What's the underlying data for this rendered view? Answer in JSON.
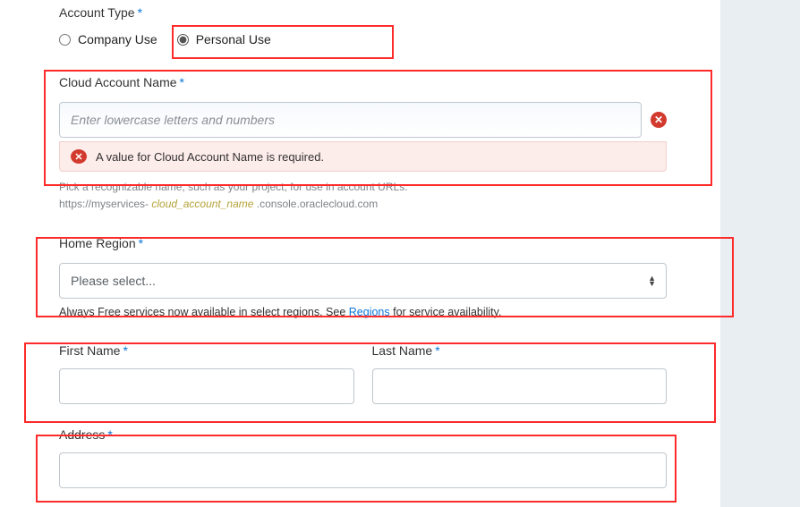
{
  "account_type": {
    "label": "Account Type",
    "options": [
      {
        "label": "Company Use",
        "selected": false
      },
      {
        "label": "Personal Use",
        "selected": true
      }
    ]
  },
  "cloud_account": {
    "label": "Cloud Account Name",
    "placeholder": "Enter lowercase letters and numbers",
    "value": "",
    "error": "A value for Cloud Account Name is required.",
    "helper_line1": "Pick a recognizable name, such as your project, for use in account URLs.",
    "helper_prefix": "https://myservices- ",
    "helper_token": "cloud_account_name",
    "helper_suffix": " .console.oraclecloud.com"
  },
  "home_region": {
    "label": "Home Region",
    "placeholder": "Please select...",
    "note_prefix": "Always Free services now available in select regions. See ",
    "note_link": "Regions",
    "note_suffix": " for service availability."
  },
  "first_name": {
    "label": "First Name",
    "value": ""
  },
  "last_name": {
    "label": "Last Name",
    "value": ""
  },
  "address": {
    "label": "Address",
    "value": ""
  },
  "asterisk": "*"
}
